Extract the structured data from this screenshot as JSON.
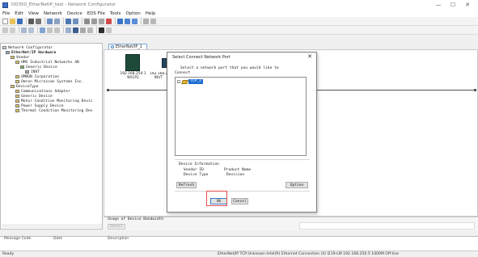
{
  "window": {
    "title": "DD350_EtherNetIP_test - Network Configurator",
    "controls": [
      "—",
      "☐",
      "✕"
    ]
  },
  "menu": [
    "File",
    "Edit",
    "View",
    "Network",
    "Device",
    "EDS File",
    "Tools",
    "Option",
    "Help"
  ],
  "tree": {
    "items": [
      {
        "label": "Network Configurator",
        "depth": 0,
        "bold": false
      },
      {
        "label": "EtherNet/IP Hardware",
        "depth": 1,
        "bold": true
      },
      {
        "label": "Vendor",
        "depth": 2,
        "bold": false
      },
      {
        "label": "HMS Industrial Networks AB",
        "depth": 3,
        "bold": false
      },
      {
        "label": "Generic Device",
        "depth": 4,
        "bold": false
      },
      {
        "label": "INVT",
        "depth": 5,
        "bold": false
      },
      {
        "label": "OMRON Corporation",
        "depth": 3,
        "bold": false
      },
      {
        "label": "Omron Microscan Systems Inc.",
        "depth": 3,
        "bold": false
      },
      {
        "label": "DeviceType",
        "depth": 2,
        "bold": false
      },
      {
        "label": "Communications Adapter",
        "depth": 3,
        "bold": false
      },
      {
        "label": "Generic Device",
        "depth": 3,
        "bold": false
      },
      {
        "label": "Motor Condition Monitoring Devic",
        "depth": 3,
        "bold": false
      },
      {
        "label": "Power Supply Device",
        "depth": 3,
        "bold": false
      },
      {
        "label": "Thermal Condition Monitoring Dev",
        "depth": 3,
        "bold": false
      }
    ]
  },
  "doc_tab": {
    "label": "EtherNet/IP_1"
  },
  "devices": [
    {
      "ip": "192.168.250.1",
      "model": "NX1P2"
    },
    {
      "ip": "192.168.250",
      "model": "INVT"
    }
  ],
  "bandwidth": {
    "label": "Usage of Device Bandwidth",
    "button": "Detail"
  },
  "bottom_headers": [
    "Message Code",
    "Date",
    "Description"
  ],
  "status": {
    "left": "Ready",
    "right": "EtherNet/IP   TCP:Unknown   Intel(R) Ethernet Connection (4) I219-LM   192.168.250.5   1000M   Off-line"
  },
  "dialog": {
    "title": "Select Connect Network Port",
    "close": "✕",
    "prompt": "Select a network port that you would like to",
    "connect_label": "Connect",
    "tree_node": "TCP_2",
    "info_title": "Device Information",
    "vendor_id_label": "Vendor ID",
    "product_name_label": "Product Name",
    "device_type_label": "Device Type",
    "revision_label": "Revision",
    "refresh_button": "Refresh",
    "option_button": "Option",
    "ok_button": "OK",
    "cancel_button": "Cancel"
  }
}
